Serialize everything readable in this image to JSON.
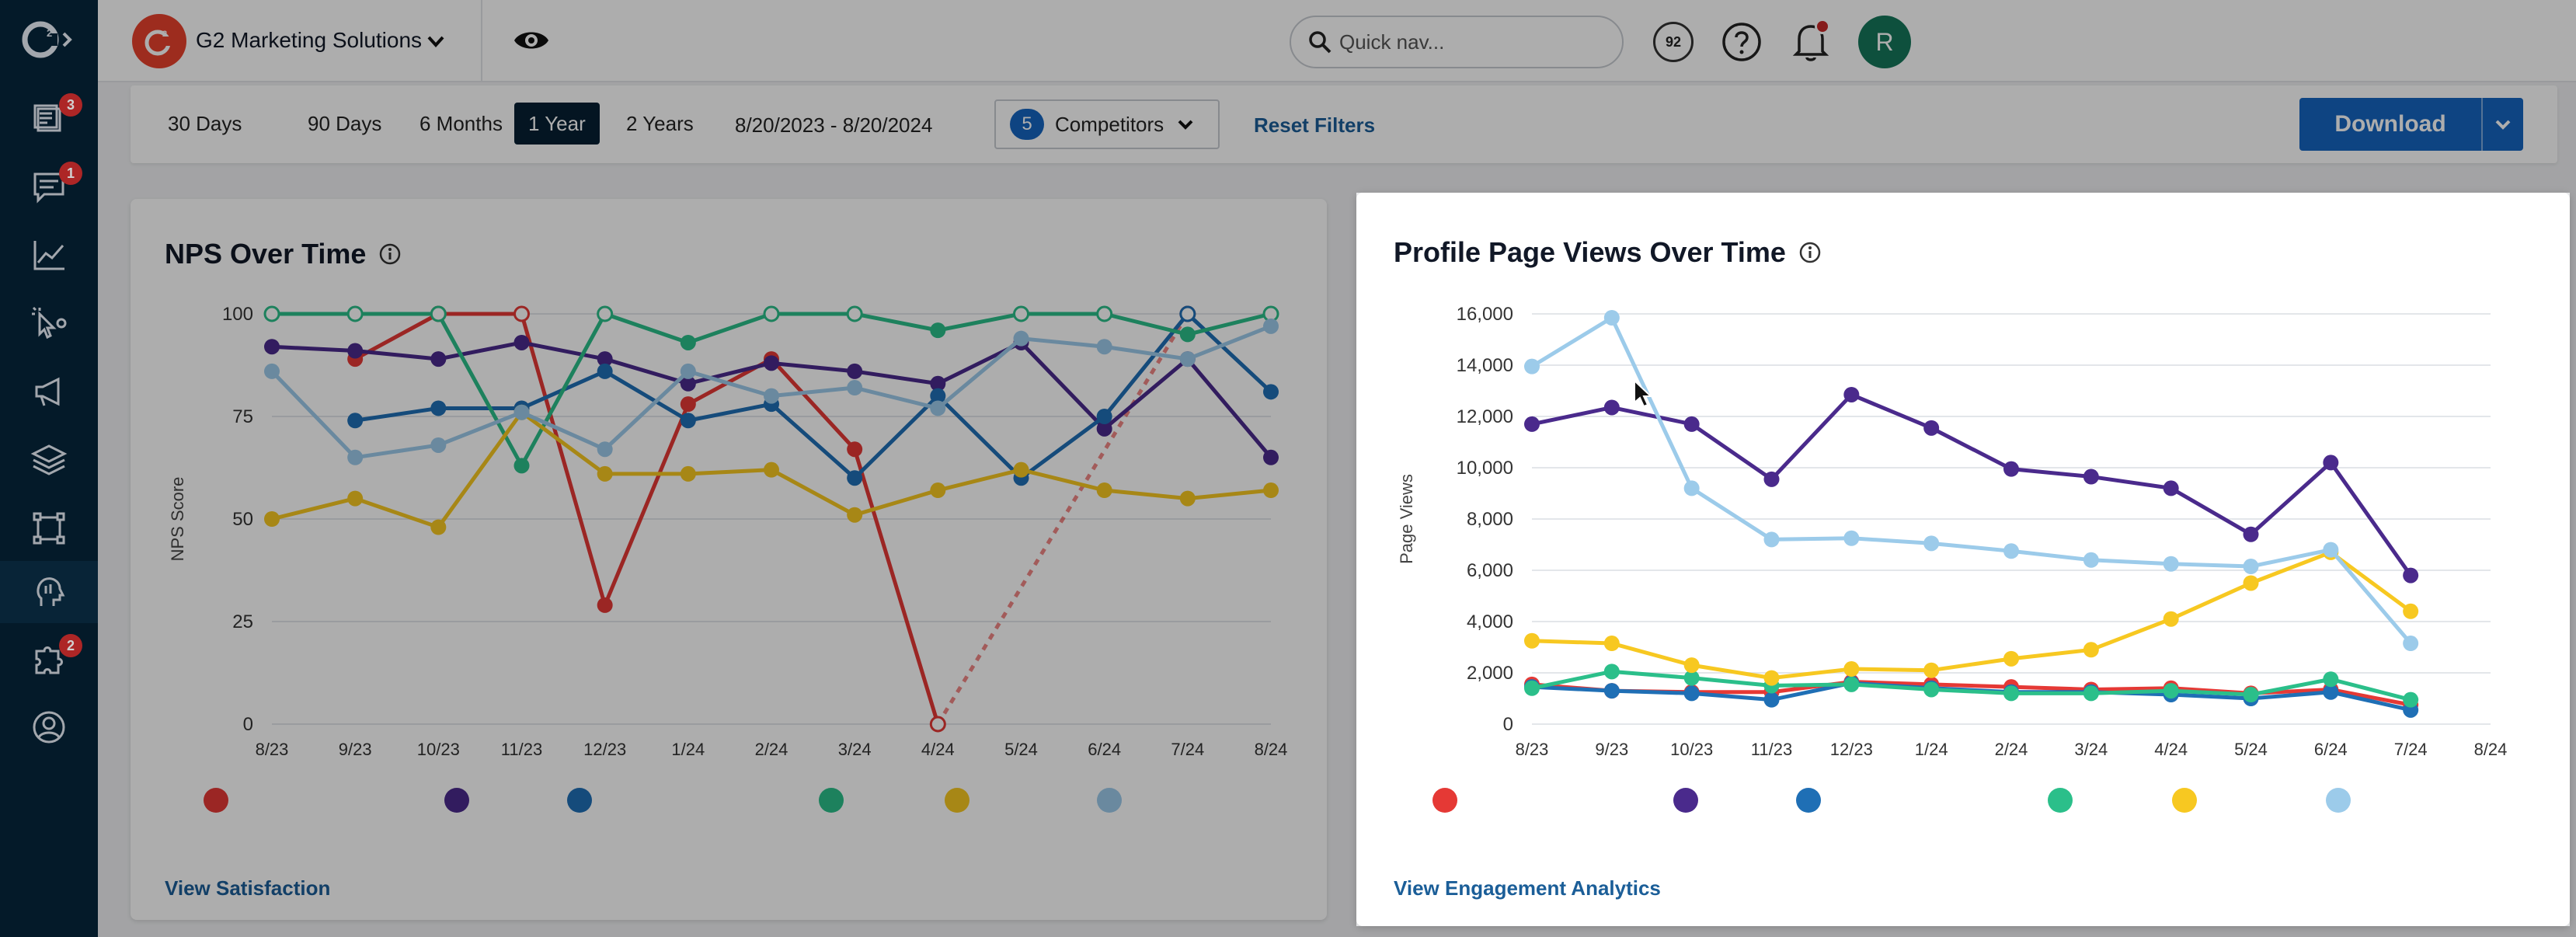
{
  "app": {
    "name": "G2 Marketing Solutions"
  },
  "sidebar": {
    "items": [
      {
        "icon": "reports-icon",
        "badge": "3"
      },
      {
        "icon": "messages-icon",
        "badge": "1"
      },
      {
        "icon": "analytics-icon",
        "badge": ""
      },
      {
        "icon": "intent-icon",
        "badge": ""
      },
      {
        "icon": "megaphone-icon",
        "badge": ""
      },
      {
        "icon": "layers-icon",
        "badge": ""
      },
      {
        "icon": "integrations-icon",
        "badge": ""
      },
      {
        "icon": "buyer-insights-icon",
        "badge": ""
      },
      {
        "icon": "puzzle-icon",
        "badge": "2"
      },
      {
        "icon": "profile-icon",
        "badge": ""
      }
    ]
  },
  "topbar": {
    "quicknav_placeholder": "Quick nav...",
    "score": "92",
    "avatar_initial": "R"
  },
  "filters": {
    "ranges": [
      "30 Days",
      "90 Days",
      "6 Months",
      "1 Year",
      "2 Years"
    ],
    "active_range": "1 Year",
    "date_range": "8/20/2023 - 8/20/2024",
    "competitors_count": "5",
    "competitors_label": "Competitors",
    "reset_label": "Reset Filters",
    "download_label": "Download"
  },
  "nps_card": {
    "title": "NPS Over Time",
    "link": "View Satisfaction"
  },
  "views_card": {
    "title": "Profile Page Views Over Time",
    "link": "View Engagement Analytics"
  },
  "colors": {
    "red": "#e53935",
    "purple": "#4a2a8c",
    "blue": "#1f6fb5",
    "green": "#2bbf8a",
    "yellow": "#f7c821",
    "lightblue": "#9ccbea"
  },
  "chart_data": [
    {
      "type": "line",
      "title": "NPS Over Time",
      "xlabel": "",
      "ylabel": "NPS Score",
      "ylim": [
        0,
        100
      ],
      "yticks": [
        "0",
        "25",
        "50",
        "75",
        "100"
      ],
      "categories": [
        "8/23",
        "9/23",
        "10/23",
        "11/23",
        "12/23",
        "1/24",
        "2/24",
        "3/24",
        "4/24",
        "5/24",
        "6/24",
        "7/24",
        "8/24"
      ],
      "grid": true,
      "series": [
        {
          "color": "red",
          "values": [
            null,
            89,
            100,
            100,
            29,
            78,
            89,
            67,
            0,
            null,
            null,
            100,
            null
          ]
        },
        {
          "color": "purple",
          "values": [
            92,
            91,
            89,
            93,
            89,
            83,
            88,
            86,
            83,
            93,
            72,
            89,
            65
          ]
        },
        {
          "color": "blue",
          "values": [
            null,
            74,
            77,
            77,
            86,
            74,
            78,
            60,
            80,
            60,
            75,
            100,
            81
          ]
        },
        {
          "color": "green",
          "values": [
            100,
            100,
            100,
            63,
            100,
            93,
            100,
            100,
            96,
            100,
            100,
            95,
            100
          ]
        },
        {
          "color": "yellow",
          "values": [
            50,
            55,
            48,
            76,
            61,
            61,
            62,
            51,
            57,
            62,
            57,
            55,
            57
          ]
        },
        {
          "color": "lightblue",
          "values": [
            86,
            65,
            68,
            76,
            67,
            86,
            80,
            82,
            77,
            94,
            92,
            89,
            97
          ]
        }
      ]
    },
    {
      "type": "line",
      "title": "Profile Page Views Over Time",
      "xlabel": "",
      "ylabel": "Page Views",
      "ylim": [
        0,
        16000
      ],
      "yticks": [
        "0",
        "2,000",
        "4,000",
        "6,000",
        "8,000",
        "10,000",
        "12,000",
        "14,000",
        "16,000"
      ],
      "categories": [
        "8/23",
        "9/23",
        "10/23",
        "11/23",
        "12/23",
        "1/24",
        "2/24",
        "3/24",
        "4/24",
        "5/24",
        "6/24",
        "7/24",
        "8/24"
      ],
      "grid": true,
      "series": [
        {
          "color": "red",
          "values": [
            1550,
            1300,
            1250,
            1250,
            1650,
            1550,
            1450,
            1350,
            1400,
            1200,
            1350,
            750,
            null
          ]
        },
        {
          "color": "purple",
          "values": [
            11700,
            12350,
            11700,
            9550,
            12850,
            11550,
            9950,
            9650,
            9200,
            7400,
            10200,
            5800,
            null
          ]
        },
        {
          "color": "blue",
          "values": [
            1450,
            1300,
            1200,
            950,
            1600,
            1400,
            1250,
            1250,
            1150,
            1000,
            1250,
            550,
            null
          ]
        },
        {
          "color": "green",
          "values": [
            1400,
            2050,
            1800,
            1500,
            1550,
            1350,
            1200,
            1200,
            1300,
            1150,
            1750,
            950,
            null
          ]
        },
        {
          "color": "yellow",
          "values": [
            3250,
            3150,
            2300,
            1800,
            2150,
            2100,
            2550,
            2900,
            4100,
            5500,
            6700,
            4400,
            null
          ]
        },
        {
          "color": "lightblue",
          "values": [
            13950,
            15850,
            9200,
            7200,
            7250,
            7050,
            6750,
            6400,
            6250,
            6150,
            6800,
            3150,
            null
          ]
        }
      ]
    }
  ]
}
